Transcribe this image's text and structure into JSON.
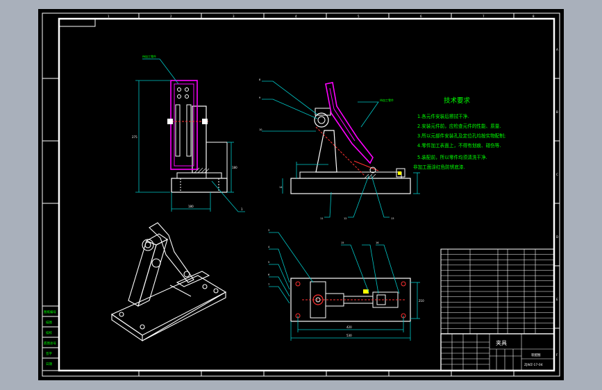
{
  "colors": {
    "background": "#a9b0bb",
    "canvas": "#000000",
    "frame": "#ffffff",
    "dimension": "#00c8c8",
    "part": "#ffffff",
    "workpiece": "#ff00ff",
    "note_text": "#00ff00",
    "red": "#ff3030",
    "yellow": "#ffff00"
  },
  "border_zone_numbers": {
    "top": [
      "1",
      "2",
      "3",
      "4",
      "5",
      "6",
      "7",
      "8"
    ],
    "left": [
      "A",
      "B",
      "C",
      "D",
      "E",
      "F"
    ]
  },
  "technical_requirements": {
    "title": "技术要求",
    "items": [
      "1.各元件安装后擦拭干净.",
      "2.安装元件前，应检查元件的性能、质量.",
      "3.所以元部件安装孔及定位孔均按实物配制;",
      "4.零件加工表面上，不得有划痕、碰伤等.",
      "5.装配前，所以零件均须清洗干净.",
      "非加工面涂红色防锈底漆."
    ]
  },
  "workpiece_labels": {
    "front": "待加工零件",
    "side": "待加工零件"
  },
  "dimensions": {
    "front_width": "180",
    "front_height": "275",
    "front_base": "180",
    "plan_length": "530",
    "plan_inner": "420",
    "plan_height": "210"
  },
  "balloons": {
    "front": [
      "1",
      "2"
    ],
    "side": [
      "8",
      "9",
      "10",
      "11",
      "12",
      "13",
      "14"
    ],
    "plan": [
      "3",
      "4",
      "5",
      "6",
      "7",
      "15",
      "16"
    ]
  },
  "title_block": {
    "drawing_name": "夹具",
    "drawing_number": "ZJWZ-17-04",
    "drawing_type": "装配图"
  },
  "side_panel_labels": [
    "图纸编号",
    "描图",
    "描校",
    "底图总号",
    "签字",
    "日期"
  ]
}
